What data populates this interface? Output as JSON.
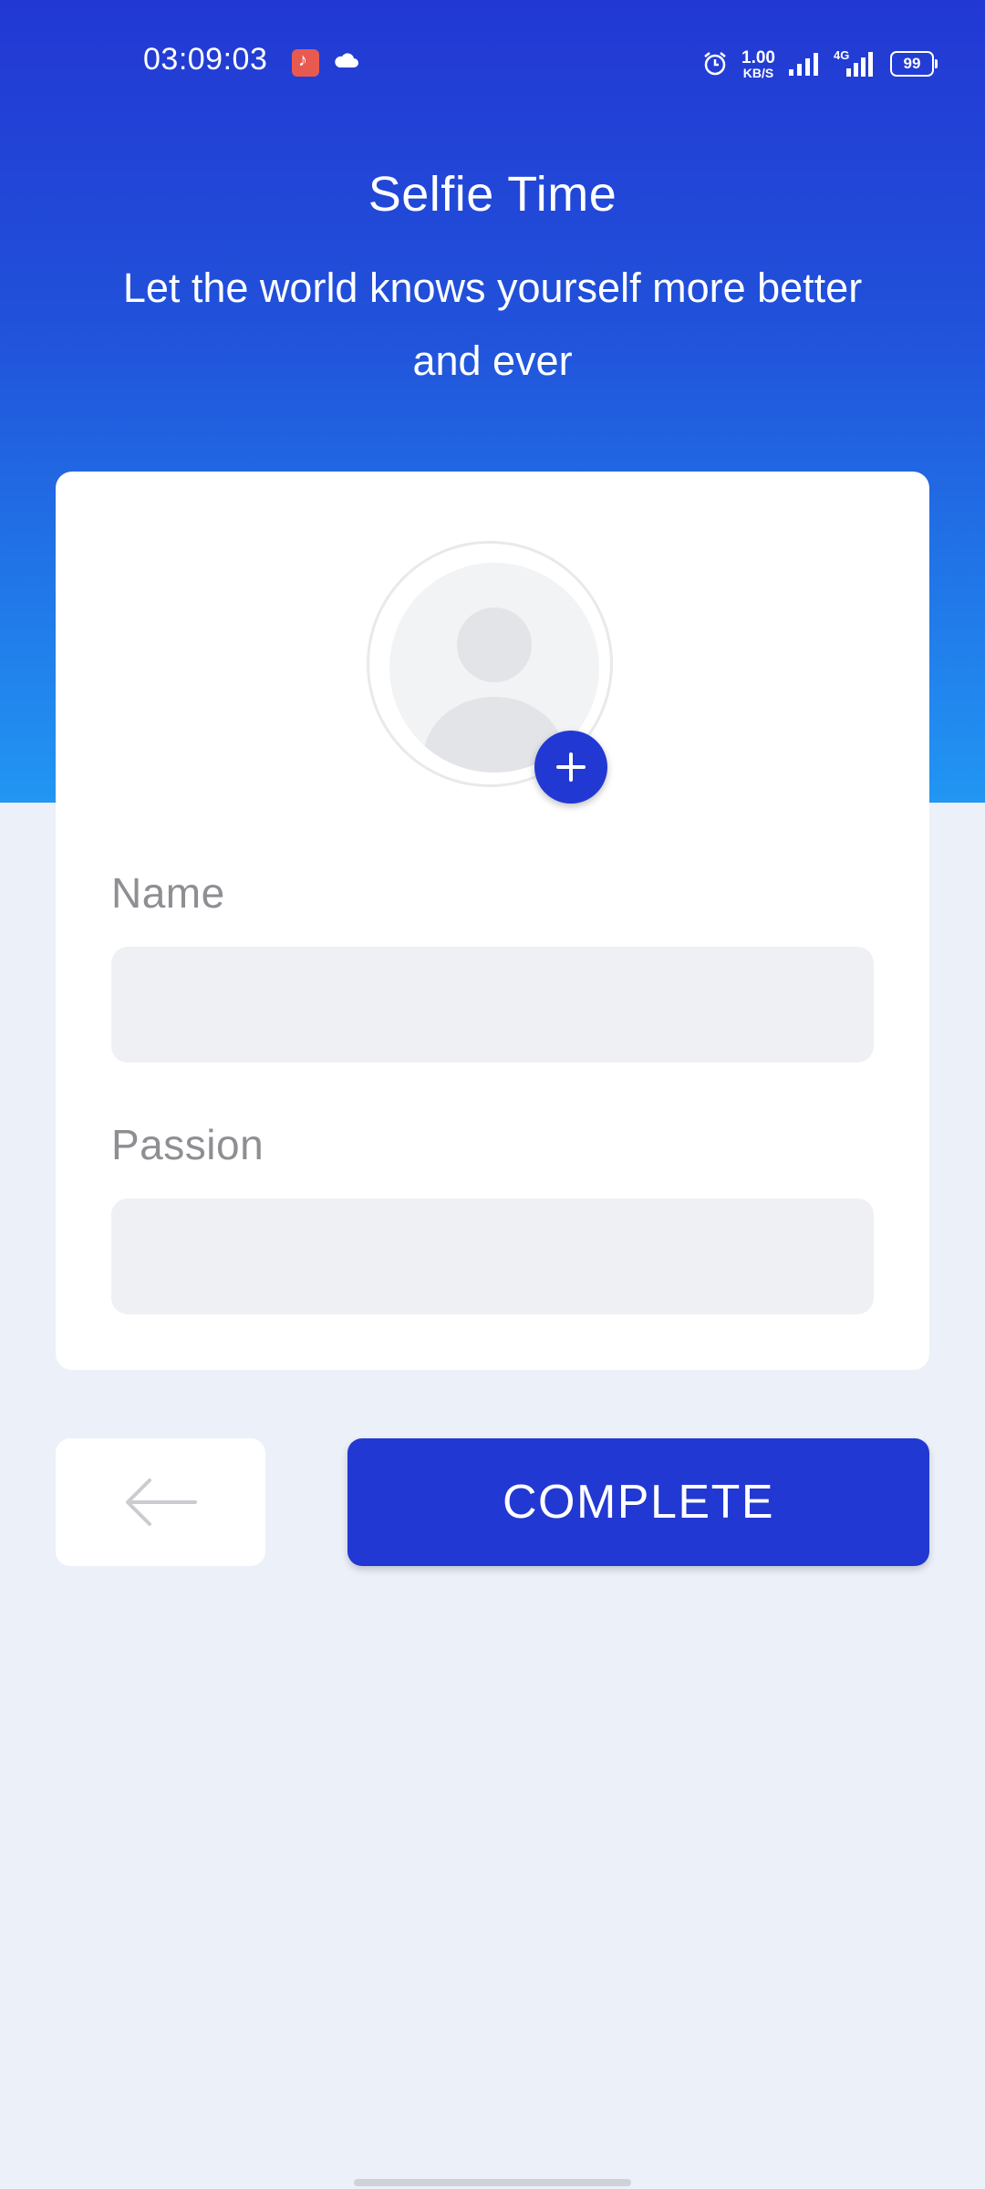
{
  "status_bar": {
    "time": "03:09:03",
    "net_speed_value": "1.00",
    "net_speed_unit": "KB/S",
    "network_label": "4G",
    "battery": "99",
    "icons": [
      "music-app-icon",
      "cloud-icon",
      "alarm-icon",
      "signal-icon",
      "signal-4g-icon",
      "battery-icon"
    ]
  },
  "header": {
    "title": "Selfie Time",
    "subtitle": "Let the world knows yourself more better and ever"
  },
  "form": {
    "name_label": "Name",
    "name_value": "",
    "passion_label": "Passion",
    "passion_value": ""
  },
  "actions": {
    "complete_label": "COMPLETE",
    "back_icon": "arrow-left-icon",
    "add_photo_icon": "plus-icon"
  },
  "colors": {
    "primary": "#2238D3",
    "gradient_bottom": "#2196F3",
    "background": "#ECF0F8",
    "input_fill": "#EFF0F4"
  }
}
